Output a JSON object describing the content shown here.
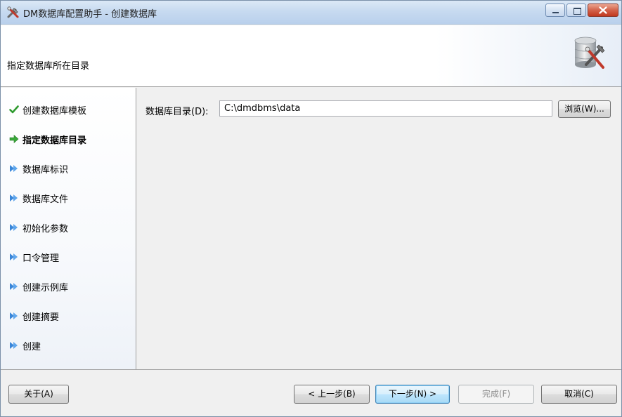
{
  "window": {
    "title": "DM数据库配置助手 - 创建数据库",
    "app_icon": "tools-icon",
    "caption_buttons": [
      "minimize-icon",
      "maximize-icon",
      "close-icon"
    ]
  },
  "header": {
    "title": "指定数据库所在目录",
    "image": "database-tools-icon"
  },
  "nav": {
    "items": [
      {
        "label": "创建数据库模板",
        "icon": "checkmark-icon",
        "state": "done"
      },
      {
        "label": "指定数据库目录",
        "icon": "arrow-right-icon",
        "state": "current"
      },
      {
        "label": "数据库标识",
        "icon": "double-arrow-icon",
        "state": "pending"
      },
      {
        "label": "数据库文件",
        "icon": "double-arrow-icon",
        "state": "pending"
      },
      {
        "label": "初始化参数",
        "icon": "double-arrow-icon",
        "state": "pending"
      },
      {
        "label": "口令管理",
        "icon": "double-arrow-icon",
        "state": "pending"
      },
      {
        "label": "创建示例库",
        "icon": "double-arrow-icon",
        "state": "pending"
      },
      {
        "label": "创建摘要",
        "icon": "double-arrow-icon",
        "state": "pending"
      },
      {
        "label": "创建",
        "icon": "double-arrow-icon",
        "state": "pending"
      }
    ]
  },
  "content": {
    "dir_label": "数据库目录(D):",
    "dir_value": "C:\\dmdbms\\data",
    "browse_label": "浏览(W)..."
  },
  "footer": {
    "about_label": "关于(A)",
    "back_label": "< 上一步(B)",
    "next_label": "下一步(N) >",
    "finish_label": "完成(F)",
    "cancel_label": "取消(C)"
  },
  "colors": {
    "titlebar": "#c7daf0",
    "check": "#2e9a2e",
    "current_arrow": "#3aa83a",
    "pending_arrow": "#3a86d8",
    "default_button_border": "#3c7fb1"
  }
}
